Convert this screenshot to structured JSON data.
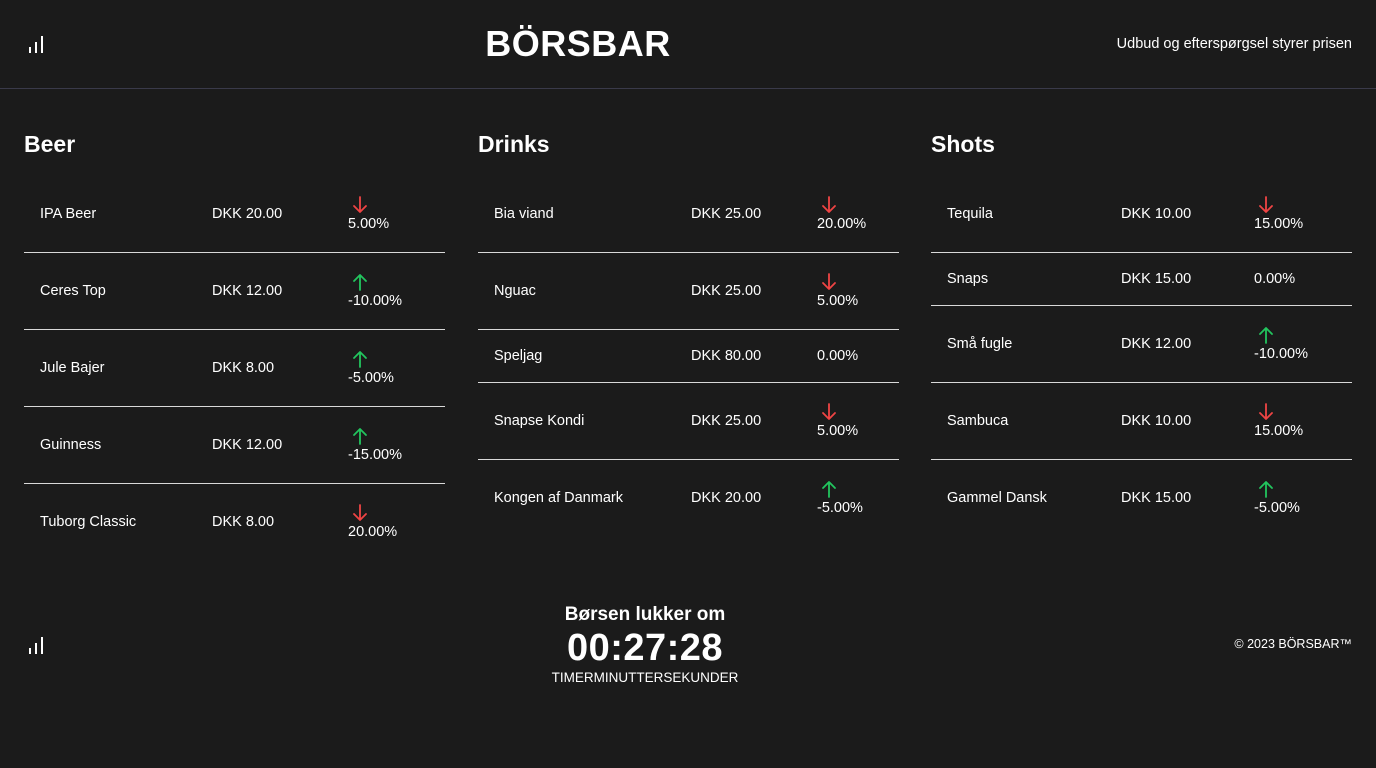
{
  "header": {
    "brand": "BÖRSBAR",
    "tagline": "Udbud og efterspørgsel styrer prisen"
  },
  "colors": {
    "background": "#1b1b1b",
    "up": "#22c55e",
    "down": "#ef4444"
  },
  "categories": [
    {
      "title": "Beer",
      "items": [
        {
          "name": "IPA Beer",
          "price": "DKK 20.00",
          "change": "5.00%",
          "arrow": "down-arrow-icon"
        },
        {
          "name": "Ceres Top",
          "price": "DKK 12.00",
          "change": "-10.00%",
          "arrow": "up-arrow-icon"
        },
        {
          "name": "Jule Bajer",
          "price": "DKK 8.00",
          "change": "-5.00%",
          "arrow": "up-arrow-icon"
        },
        {
          "name": "Guinness",
          "price": "DKK 12.00",
          "change": "-15.00%",
          "arrow": "up-arrow-icon"
        },
        {
          "name": "Tuborg Classic",
          "price": "DKK 8.00",
          "change": "20.00%",
          "arrow": "down-arrow-icon"
        }
      ]
    },
    {
      "title": "Drinks",
      "items": [
        {
          "name": "Bia viand",
          "price": "DKK 25.00",
          "change": "20.00%",
          "arrow": "down-arrow-icon"
        },
        {
          "name": "Nguac",
          "price": "DKK 25.00",
          "change": "5.00%",
          "arrow": "down-arrow-icon"
        },
        {
          "name": "Speljag",
          "price": "DKK 80.00",
          "change": "0.00%",
          "arrow": null
        },
        {
          "name": "Snapse Kondi",
          "price": "DKK 25.00",
          "change": "5.00%",
          "arrow": "down-arrow-icon"
        },
        {
          "name": "Kongen af Danmark",
          "price": "DKK 20.00",
          "change": "-5.00%",
          "arrow": "up-arrow-icon"
        }
      ]
    },
    {
      "title": "Shots",
      "items": [
        {
          "name": "Tequila",
          "price": "DKK 10.00",
          "change": "15.00%",
          "arrow": "down-arrow-icon"
        },
        {
          "name": "Snaps",
          "price": "DKK 15.00",
          "change": "0.00%",
          "arrow": null
        },
        {
          "name": "Små fugle",
          "price": "DKK 12.00",
          "change": "-10.00%",
          "arrow": "up-arrow-icon"
        },
        {
          "name": "Sambuca",
          "price": "DKK 10.00",
          "change": "15.00%",
          "arrow": "down-arrow-icon"
        },
        {
          "name": "Gammel Dansk",
          "price": "DKK 15.00",
          "change": "-5.00%",
          "arrow": "up-arrow-icon"
        }
      ]
    }
  ],
  "timer": {
    "label": "Børsen lukker om",
    "value": "00:27:28",
    "units": "TIMERMINUTTERSEKUNDER"
  },
  "footer": {
    "copyright": "© 2023 BÖRSBAR™"
  }
}
